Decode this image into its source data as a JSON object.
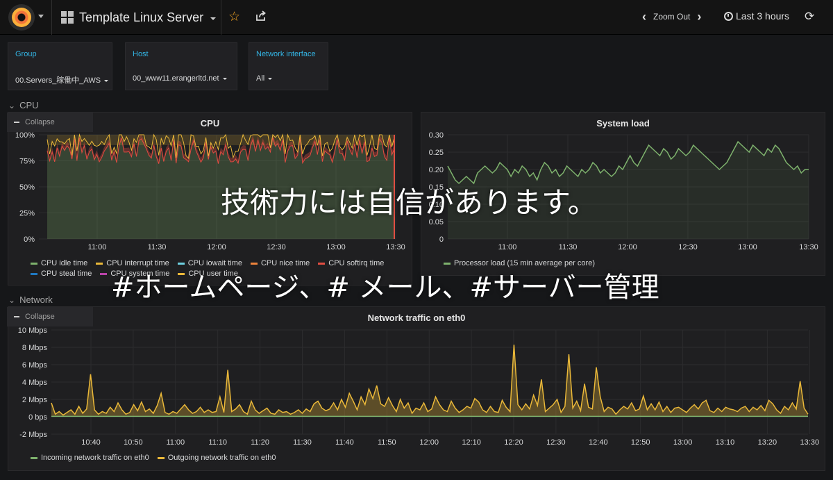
{
  "header": {
    "dashboard_title": "Template Linux Server",
    "zoom_out_label": "Zoom Out",
    "time_range_label": "Last 3 hours"
  },
  "template_variables": [
    {
      "label": "Group",
      "value": "00.Servers_稼働中_AWS"
    },
    {
      "label": "Host",
      "value": "00_www11.erangerltd.net"
    },
    {
      "label": "Network interface",
      "value": "All"
    }
  ],
  "rows": [
    {
      "title": "CPU",
      "collapse_label": "Collapse"
    },
    {
      "title": "Network",
      "collapse_label": "Collapse"
    }
  ],
  "overlay": {
    "line1": "技術力には自信があります。",
    "line2": "#ホームページ、# メール、#サーバー管理"
  },
  "colors": {
    "green": "#7eb26d",
    "yellow": "#eab839",
    "light_green": "#6ed0e0",
    "orange": "#ef843c",
    "red": "#e24d42",
    "blue": "#1f78c1",
    "purple": "#ba43a9",
    "brand_orange": "#f2743a",
    "accent_blue": "#33b5e5",
    "star": "#f5a623"
  },
  "chart_data": [
    {
      "title": "CPU",
      "type": "area",
      "x": [
        "11:00",
        "11:30",
        "12:00",
        "12:30",
        "13:00",
        "13:30"
      ],
      "y_ticks": [
        "100%",
        "75%",
        "50%",
        "25%",
        "0%"
      ],
      "ylim": [
        0,
        100
      ],
      "grid": true,
      "legend_position": "bottom",
      "series": [
        {
          "name": "CPU idle time",
          "color": "#7eb26d",
          "approx_level": 90
        },
        {
          "name": "CPU interrupt time",
          "color": "#eab839",
          "approx_level": 0
        },
        {
          "name": "CPU iowait time",
          "color": "#6ed0e0",
          "approx_level": 0
        },
        {
          "name": "CPU nice time",
          "color": "#ef843c",
          "approx_level": 0
        },
        {
          "name": "CPU softirq time",
          "color": "#e24d42",
          "approx_level": 0
        },
        {
          "name": "CPU steal time",
          "color": "#1f78c1",
          "approx_level": 0
        },
        {
          "name": "CPU system time",
          "color": "#ba43a9",
          "approx_level": 4
        },
        {
          "name": "CPU user time",
          "color": "#eab839",
          "approx_level": 6
        }
      ]
    },
    {
      "title": "System load",
      "type": "line",
      "x": [
        "11:00",
        "11:30",
        "12:00",
        "12:30",
        "13:00",
        "13:30"
      ],
      "y_ticks": [
        "0.30",
        "0.25",
        "0.20",
        "0.15",
        "0.10",
        "0.05",
        "0"
      ],
      "ylim": [
        0,
        0.3
      ],
      "grid": true,
      "legend_position": "bottom",
      "series": [
        {
          "name": "Processor load (15 min average per core)",
          "color": "#7eb26d",
          "values": [
            0.21,
            0.19,
            0.17,
            0.16,
            0.17,
            0.18,
            0.17,
            0.16,
            0.19,
            0.2,
            0.21,
            0.2,
            0.19,
            0.2,
            0.22,
            0.21,
            0.2,
            0.18,
            0.2,
            0.19,
            0.21,
            0.2,
            0.18,
            0.19,
            0.17,
            0.2,
            0.22,
            0.21,
            0.19,
            0.2,
            0.18,
            0.19,
            0.21,
            0.2,
            0.19,
            0.18,
            0.2,
            0.19,
            0.2,
            0.22,
            0.21,
            0.19,
            0.2,
            0.19,
            0.18,
            0.19,
            0.21,
            0.2,
            0.22,
            0.24,
            0.22,
            0.21,
            0.23,
            0.25,
            0.27,
            0.26,
            0.25,
            0.24,
            0.26,
            0.25,
            0.23,
            0.24,
            0.26,
            0.25,
            0.24,
            0.25,
            0.27,
            0.26,
            0.25,
            0.24,
            0.23,
            0.22,
            0.21,
            0.2,
            0.21,
            0.22,
            0.24,
            0.26,
            0.28,
            0.27,
            0.26,
            0.25,
            0.27,
            0.26,
            0.25,
            0.24,
            0.26,
            0.25,
            0.27,
            0.26,
            0.24,
            0.22,
            0.21,
            0.2,
            0.21,
            0.19,
            0.2,
            0.2
          ]
        }
      ]
    },
    {
      "title": "Network traffic on eth0",
      "type": "area",
      "x": [
        "10:40",
        "10:50",
        "11:00",
        "11:10",
        "11:20",
        "11:30",
        "11:40",
        "11:50",
        "12:00",
        "12:10",
        "12:20",
        "12:30",
        "12:40",
        "12:50",
        "13:00",
        "13:10",
        "13:20",
        "13:30"
      ],
      "y_ticks": [
        "10 Mbps",
        "8 Mbps",
        "6 Mbps",
        "4 Mbps",
        "2 Mbps",
        "0 bps",
        "-2 Mbps"
      ],
      "ylim": [
        -2,
        10
      ],
      "grid": true,
      "legend_position": "bottom",
      "series": [
        {
          "name": "Incoming network traffic on eth0",
          "color": "#7eb26d",
          "values": [
            0.05,
            0.05,
            0.05,
            0.05,
            0.05,
            0.05,
            0.05,
            0.05,
            0.05,
            0.05,
            0.05,
            0.05,
            0.05,
            0.05,
            0.05,
            0.05,
            0.05,
            0.05,
            0.05,
            0.05,
            0.05,
            0.05,
            0.05,
            0.05,
            0.05,
            0.05,
            0.05,
            0.05,
            0.05,
            0.05,
            0.05,
            0.05,
            0.05,
            0.05,
            0.05,
            0.05,
            0.05,
            0.05,
            0.05,
            0.05,
            0.05,
            0.05,
            0.05,
            0.05,
            0.05,
            0.05,
            0.05,
            0.05,
            0.05,
            0.05,
            0.05,
            0.05,
            0.05,
            0.05,
            0.05,
            0.05,
            0.05,
            0.05,
            0.05,
            0.05,
            0.05,
            0.05,
            0.05,
            0.05,
            0.05,
            0.05,
            0.05,
            0.05,
            0.05,
            0.05,
            0.05,
            0.05,
            0.05,
            0.05,
            0.05,
            0.05,
            0.05,
            0.05,
            0.05,
            0.05,
            0.05,
            0.05,
            0.05,
            0.05,
            0.05,
            0.05,
            0.05,
            0.05,
            0.05,
            0.05,
            0.05,
            0.05,
            0.05,
            0.05,
            0.05,
            0.05,
            0.05,
            0.05,
            0.05,
            0.05,
            0.05,
            0.05,
            0.05,
            0.05,
            0.05,
            0.05,
            0.05,
            0.05,
            0.05,
            0.05,
            0.05,
            0.05,
            0.05,
            0.05,
            0.05,
            0.05,
            0.05,
            0.05,
            0.05,
            0.05,
            0.05,
            0.05,
            0.05,
            0.05,
            0.05,
            0.05,
            0.05,
            0.05,
            0.05,
            0.05,
            0.05,
            0.05,
            0.05,
            0.05,
            0.05,
            0.05,
            0.05,
            0.05,
            0.05,
            0.05,
            0.05,
            0.05,
            0.05,
            0.05,
            0.05,
            0.05,
            0.05,
            0.05,
            0.05,
            0.05,
            0.05,
            0.05,
            0.05,
            0.05,
            0.05,
            0.05,
            0.05,
            0.05,
            0.05,
            0.05,
            0.05,
            0.05,
            0.05,
            0.05,
            0.05,
            0.05,
            0.05,
            0.05,
            0.05,
            0.05,
            0.05,
            0.05
          ]
        },
        {
          "name": "Outgoing network traffic on eth0",
          "color": "#eab839",
          "values": [
            1.6,
            0.3,
            0.6,
            0.2,
            0.5,
            0.8,
            0.3,
            1.2,
            0.4,
            0.9,
            4.9,
            0.8,
            0.3,
            0.6,
            0.4,
            1.1,
            0.6,
            1.6,
            0.8,
            0.3,
            0.5,
            1.4,
            0.7,
            1.7,
            0.6,
            0.9,
            0.4,
            1.3,
            2.7,
            0.5,
            0.3,
            0.6,
            0.4,
            0.9,
            1.4,
            0.8,
            0.4,
            0.6,
            1.1,
            0.5,
            0.8,
            0.5,
            0.6,
            2.3,
            0.5,
            5.4,
            0.6,
            0.9,
            1.4,
            0.6,
            0.3,
            1.8,
            0.8,
            0.4,
            0.7,
            1.0,
            0.4,
            0.3,
            0.8,
            0.5,
            0.6,
            0.3,
            0.5,
            0.8,
            0.4,
            0.9,
            0.6,
            1.5,
            1.8,
            1.0,
            0.7,
            0.9,
            1.6,
            0.8,
            2.0,
            1.1,
            2.7,
            1.8,
            0.8,
            2.3,
            1.4,
            3.2,
            2.1,
            3.6,
            1.5,
            1.2,
            2.2,
            1.3,
            0.6,
            2.0,
            1.0,
            1.6,
            0.4,
            1.0,
            0.8,
            1.6,
            0.6,
            0.9,
            2.3,
            1.4,
            0.8,
            0.6,
            1.8,
            1.0,
            0.5,
            0.8,
            1.2,
            1.0,
            2.1,
            1.7,
            0.8,
            0.5,
            1.2,
            0.6,
            0.5,
            1.9,
            1.1,
            0.6,
            8.3,
            1.4,
            0.8,
            1.5,
            0.9,
            2.5,
            1.3,
            4.3,
            0.6,
            1.0,
            1.4,
            2.0,
            0.5,
            1.2,
            7.2,
            1.0,
            1.8,
            0.7,
            3.8,
            1.1,
            0.9,
            5.7,
            2.3,
            0.6,
            1.1,
            0.9,
            0.3,
            0.8,
            1.2,
            0.9,
            1.6,
            0.7,
            0.9,
            2.4,
            0.8,
            1.5,
            0.8,
            1.7,
            0.6,
            1.2,
            0.5,
            1.0,
            1.1,
            0.8,
            0.5,
            1.0,
            1.4,
            0.9,
            1.6,
            1.9,
            0.7,
            0.5,
            1.0,
            0.6,
            1.1,
            0.9,
            0.8,
            0.6,
            1.0,
            1.2,
            0.6,
            1.1,
            0.8,
            1.3,
            0.7,
            1.9,
            1.5,
            0.8,
            0.4,
            1.2,
            0.8,
            1.6,
            0.9,
            4.1,
            1.0,
            0.3
          ]
        }
      ]
    }
  ]
}
